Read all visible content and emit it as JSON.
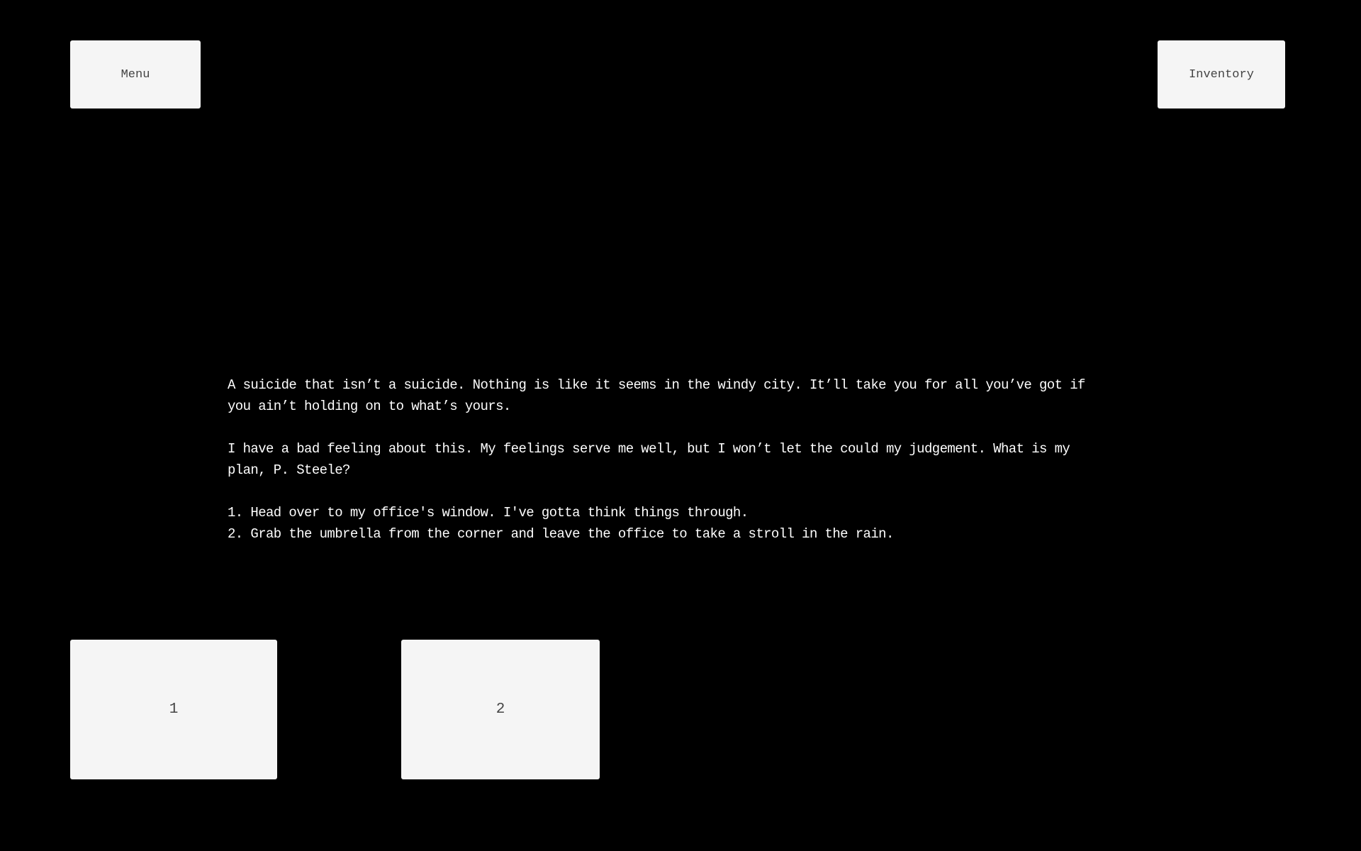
{
  "header": {
    "menu_label": "Menu",
    "inventory_label": "Inventory"
  },
  "story": {
    "paragraphs": [
      "A suicide that isn’t a suicide. Nothing is like it seems in the windy city. It’ll take you for all you’ve got if you ain’t holding on to what’s yours.",
      "I have a bad feeling about this.  My feelings serve me well, but I won’t let the could my judgement. What is my plan, P. Steele?"
    ],
    "options": [
      "1. Head over to my office's window. I've gotta think things through.",
      "2. Grab the umbrella from the corner and leave the office to take a stroll in the rain."
    ]
  },
  "choices": [
    {
      "label": "1"
    },
    {
      "label": "2"
    }
  ]
}
